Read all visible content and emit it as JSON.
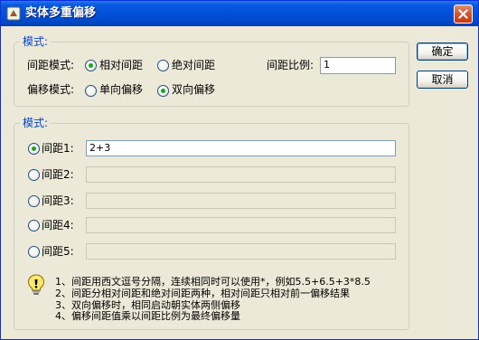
{
  "window": {
    "title": "实体多重偏移"
  },
  "mode_group": {
    "title": "模式:",
    "spacing_mode": {
      "label": "间距模式:",
      "options": [
        "相对间距",
        "绝对间距"
      ],
      "selected": "相对间距"
    },
    "offset_mode": {
      "label": "偏移模式:",
      "options": [
        "单向偏移",
        "双向偏移"
      ],
      "selected": "双向偏移"
    },
    "ratio": {
      "label": "间距比例:",
      "value": "1"
    }
  },
  "buttons": {
    "ok": "确定",
    "cancel": "取消"
  },
  "spacing_group": {
    "title": "模式:",
    "rows": [
      {
        "label": "间距1:",
        "value": "2+3",
        "selected": true,
        "enabled": true
      },
      {
        "label": "间距2:",
        "value": "",
        "selected": false,
        "enabled": false
      },
      {
        "label": "间距3:",
        "value": "",
        "selected": false,
        "enabled": false
      },
      {
        "label": "间距4:",
        "value": "",
        "selected": false,
        "enabled": false
      },
      {
        "label": "间距5:",
        "value": "",
        "selected": false,
        "enabled": false
      }
    ]
  },
  "notes": [
    "1、间距用西文逗号分隔，连续相同时可以使用*，例如5.5+6.5+3*8.5",
    "2、间距分相对间距和绝对间距两种，相对间距只相对前一偏移结果",
    "3、双向偏移时，相同启动朝实体两侧偏移",
    "4、偏移间距值乘以间距比例为最终偏移量"
  ],
  "icons": {
    "app": "app-icon",
    "close": "close-icon",
    "hint": "lightbulb-icon"
  }
}
